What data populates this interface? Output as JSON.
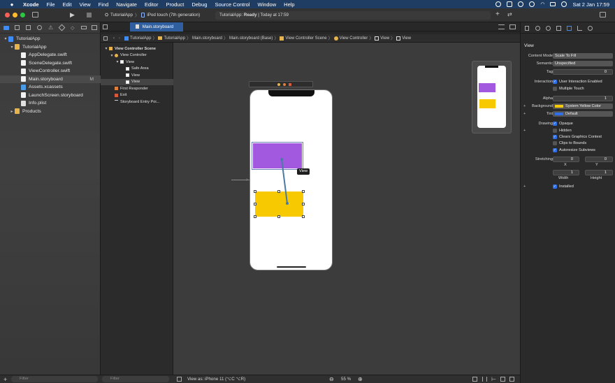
{
  "menubar": {
    "apple": "",
    "app_name": "Xcode",
    "items": [
      "File",
      "Edit",
      "View",
      "Find",
      "Navigate",
      "Editor",
      "Product",
      "Debug",
      "Source Control",
      "Window",
      "Help"
    ],
    "clock": "Sat 2 Jan  17:59"
  },
  "toolbar": {
    "scheme": "TutorialApp",
    "device": "iPod touch (7th generation)",
    "activity_app": "TutorialApp:",
    "activity_status": "Ready",
    "activity_time": "| Today at 17:59"
  },
  "editor_tab": {
    "label": "Main.storyboard"
  },
  "jumpbar": {
    "items": [
      "TutorialApp",
      "TutorialApp",
      "Main.storyboard",
      "Main.storyboard (Base)",
      "View Controller Scene",
      "View Controller",
      "View",
      "View"
    ]
  },
  "navigator": {
    "rows": [
      {
        "label": "TutorialApp",
        "indent": 0,
        "kind": "project",
        "disclosure": "▾",
        "badge": ""
      },
      {
        "label": "TutorialApp",
        "indent": 1,
        "kind": "folder",
        "disclosure": "▾",
        "badge": ""
      },
      {
        "label": "AppDelegate.swift",
        "indent": 2,
        "kind": "swift",
        "disclosure": "",
        "badge": ""
      },
      {
        "label": "SceneDelegate.swift",
        "indent": 2,
        "kind": "swift",
        "disclosure": "",
        "badge": ""
      },
      {
        "label": "ViewController.swift",
        "indent": 2,
        "kind": "swift",
        "disclosure": "",
        "badge": ""
      },
      {
        "label": "Main.storyboard",
        "indent": 2,
        "kind": "storyboard",
        "disclosure": "",
        "badge": "M"
      },
      {
        "label": "Assets.xcassets",
        "indent": 2,
        "kind": "assets",
        "disclosure": "",
        "badge": ""
      },
      {
        "label": "LaunchScreen.storyboard",
        "indent": 2,
        "kind": "storyboard",
        "disclosure": "",
        "badge": ""
      },
      {
        "label": "Info.plist",
        "indent": 2,
        "kind": "plist",
        "disclosure": "",
        "badge": ""
      },
      {
        "label": "Products",
        "indent": 1,
        "kind": "folder",
        "disclosure": "▸",
        "badge": ""
      }
    ],
    "filter_placeholder": "Filter"
  },
  "outline": {
    "rows": [
      {
        "label": "View Controller Scene",
        "indent": 0,
        "disclosure": "▾",
        "bold": true
      },
      {
        "label": "View Controller",
        "indent": 1,
        "disclosure": "▾",
        "bold": false
      },
      {
        "label": "View",
        "indent": 2,
        "disclosure": "▾",
        "bold": false
      },
      {
        "label": "Safe Area",
        "indent": 3,
        "disclosure": "",
        "bold": false
      },
      {
        "label": "View",
        "indent": 3,
        "disclosure": "",
        "bold": false
      },
      {
        "label": "View",
        "indent": 3,
        "disclosure": "",
        "bold": false
      },
      {
        "label": "First Responder",
        "indent": 1,
        "disclosure": "",
        "bold": false
      },
      {
        "label": "Exit",
        "indent": 1,
        "disclosure": "",
        "bold": false
      },
      {
        "label": "Storyboard Entry Poi...",
        "indent": 1,
        "disclosure": "",
        "bold": false
      }
    ],
    "filter_placeholder": "Filter"
  },
  "canvas": {
    "tooltip": "View",
    "colors": {
      "purple": "#a259e0",
      "yellow": "#f7c900"
    }
  },
  "bottombar": {
    "view_as": "View as: iPhone 11 (⌥C ⌥R)",
    "zoom": "55 %"
  },
  "inspector": {
    "section_title": "View",
    "content_mode_label": "Content Mode",
    "content_mode_value": "Scale To Fill",
    "semantic_label": "Semantic",
    "semantic_value": "Unspecified",
    "tag_label": "Tag",
    "tag_value": "0",
    "interaction_label": "Interaction",
    "user_interaction": "User Interaction Enabled",
    "multiple_touch": "Multiple Touch",
    "alpha_label": "Alpha",
    "alpha_value": "1",
    "background_label": "Background",
    "background_value": "System Yellow Color",
    "background_color": "#f7c900",
    "tint_label": "Tint",
    "tint_value": "Default",
    "tint_color": "#2f6ee6",
    "drawing_label": "Drawing",
    "opaque": "Opaque",
    "hidden": "Hidden",
    "clears_graphics": "Clears Graphics Context",
    "clips_bounds": "Clips to Bounds",
    "autoresize": "Autoresize Subviews",
    "stretching_label": "Stretching",
    "stretch_x": "0",
    "stretch_y": "0",
    "stretch_w": "1",
    "stretch_h": "1",
    "x_label": "X",
    "y_label": "Y",
    "width_label": "Width",
    "height_label": "Height",
    "installed": "Installed"
  }
}
